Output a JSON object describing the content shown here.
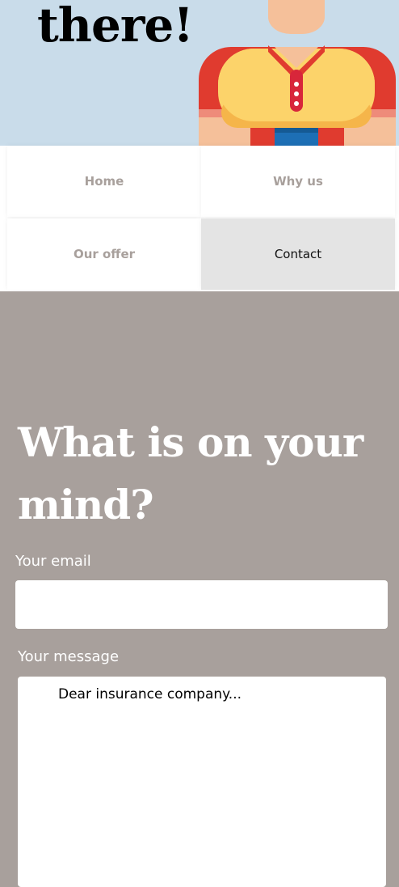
{
  "hero": {
    "title": "there!",
    "illustration": "person-illustration",
    "background": "#c9dcea"
  },
  "nav": {
    "items": [
      {
        "label": "Home",
        "active": false
      },
      {
        "label": "Why us",
        "active": false
      },
      {
        "label": "Our offer",
        "active": false
      },
      {
        "label": "Contact",
        "active": true
      }
    ]
  },
  "contact": {
    "heading": "What is on your mind?",
    "email_label": "Your email",
    "email_value": "",
    "message_label": "Your message",
    "message_placeholder": "Dear insurance company...",
    "background": "#a8a09c"
  }
}
